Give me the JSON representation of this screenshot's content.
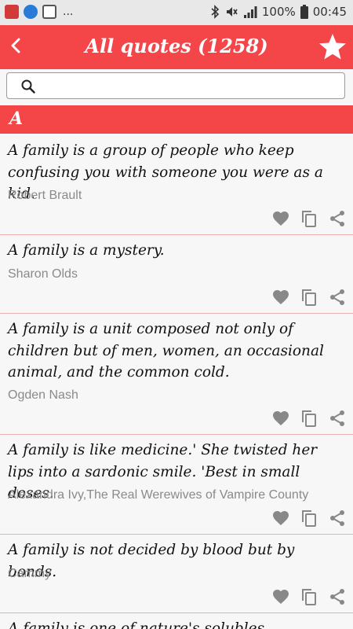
{
  "status_bar": {
    "battery": "100%",
    "time": "00:45",
    "overflow": "..."
  },
  "app_bar": {
    "title": "All quotes (1258)"
  },
  "search": {
    "placeholder": "",
    "value": ""
  },
  "section": {
    "letter": "A"
  },
  "quotes": [
    {
      "text": "A family is a group of people who keep confusing you with someone you were as a kid.",
      "author": "Robert Brault"
    },
    {
      "text": "A family is a mystery.",
      "author": "Sharon Olds"
    },
    {
      "text": "A family is a unit composed not only of children but of men, women, an occasional animal, and the common cold.",
      "author": "Ogden Nash"
    },
    {
      "text": "A family is like medicine.' She twisted her lips into a sardonic smile. 'Best in small doses.",
      "author": "Alexandra Ivy,The Real Werewives of Vampire County"
    },
    {
      "text": "A family is not decided by blood but by bonds.",
      "author": "Cammy"
    },
    {
      "text": "A family is one of nature's solubles",
      "author": ""
    }
  ],
  "icons": {
    "back": "chevron-left-icon",
    "favorite_all": "star-icon",
    "search": "search-icon",
    "like": "heart-icon",
    "copy": "copy-icon",
    "share": "share-icon"
  },
  "colors": {
    "accent": "#f44549",
    "status_bar": "#e8e8e8",
    "divider": "#e9b1b2",
    "author": "#8a8a8a",
    "action_icon": "#888888"
  }
}
